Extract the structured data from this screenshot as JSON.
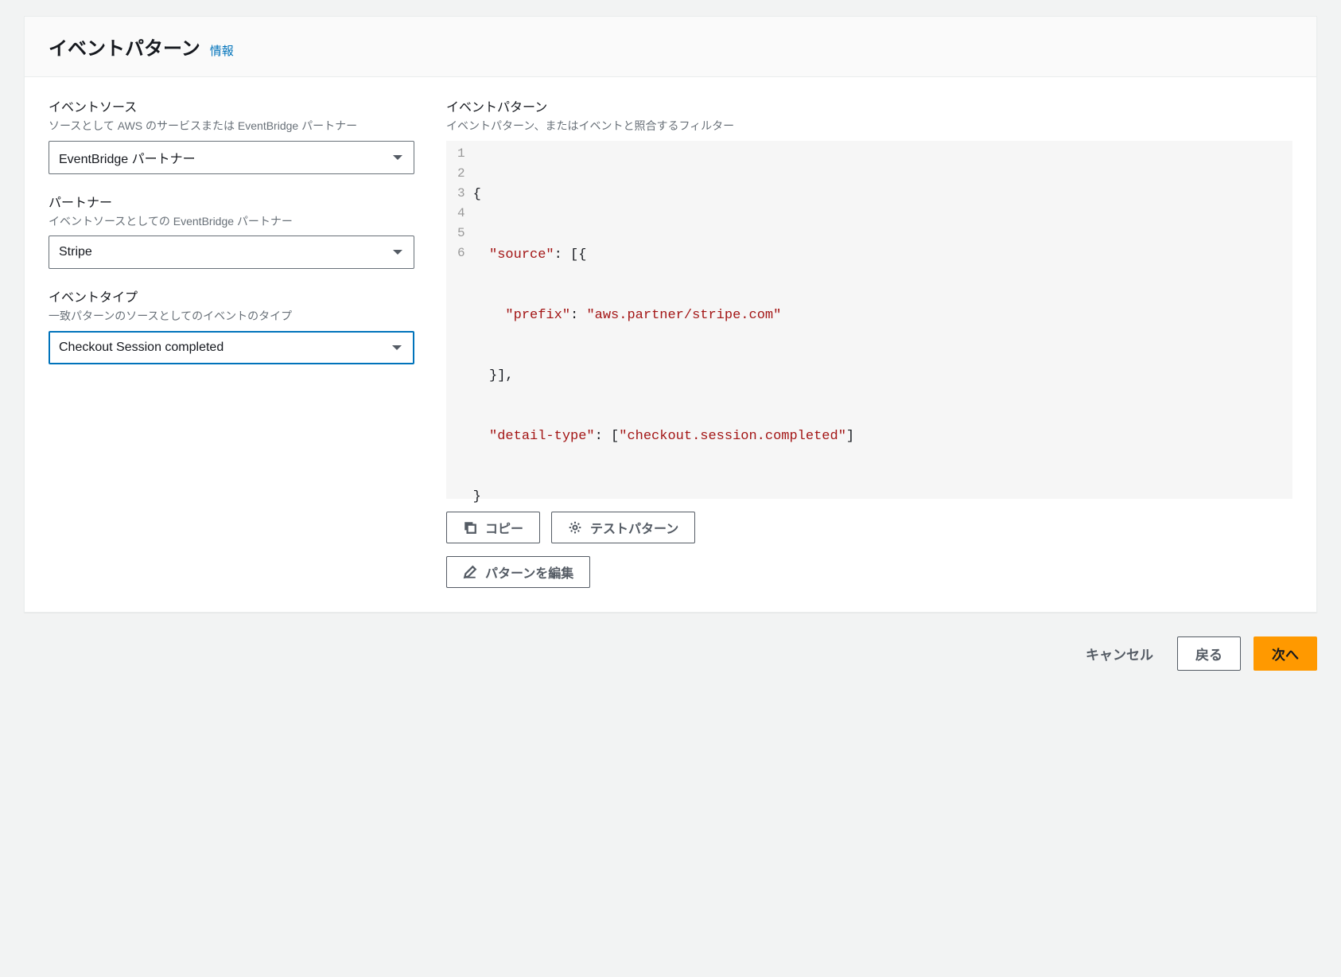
{
  "panel": {
    "title": "イベントパターン",
    "info_link": "情報"
  },
  "left": {
    "event_source": {
      "label": "イベントソース",
      "hint": "ソースとして AWS のサービスまたは EventBridge パートナー",
      "value": "EventBridge パートナー"
    },
    "partner": {
      "label": "パートナー",
      "hint": "イベントソースとしての EventBridge パートナー",
      "value": "Stripe"
    },
    "event_type": {
      "label": "イベントタイプ",
      "hint": "一致パターンのソースとしてのイベントのタイプ",
      "value": "Checkout Session completed"
    }
  },
  "right": {
    "label": "イベントパターン",
    "hint": "イベントパターン、またはイベントと照合するフィルター",
    "code": {
      "lines": [
        "1",
        "2",
        "3",
        "4",
        "5",
        "6"
      ],
      "l1": "{",
      "l2a": "  ",
      "l2key": "\"source\"",
      "l2b": ": [{",
      "l3a": "    ",
      "l3key": "\"prefix\"",
      "l3b": ": ",
      "l3str": "\"aws.partner/stripe.com\"",
      "l4": "  }],",
      "l5a": "  ",
      "l5key": "\"detail-type\"",
      "l5b": ": [",
      "l5str": "\"checkout.session.completed\"",
      "l5c": "]",
      "l6": "}"
    },
    "buttons": {
      "copy": "コピー",
      "test": "テストパターン",
      "edit": "パターンを編集"
    }
  },
  "footer": {
    "cancel": "キャンセル",
    "back": "戻る",
    "next": "次へ"
  }
}
